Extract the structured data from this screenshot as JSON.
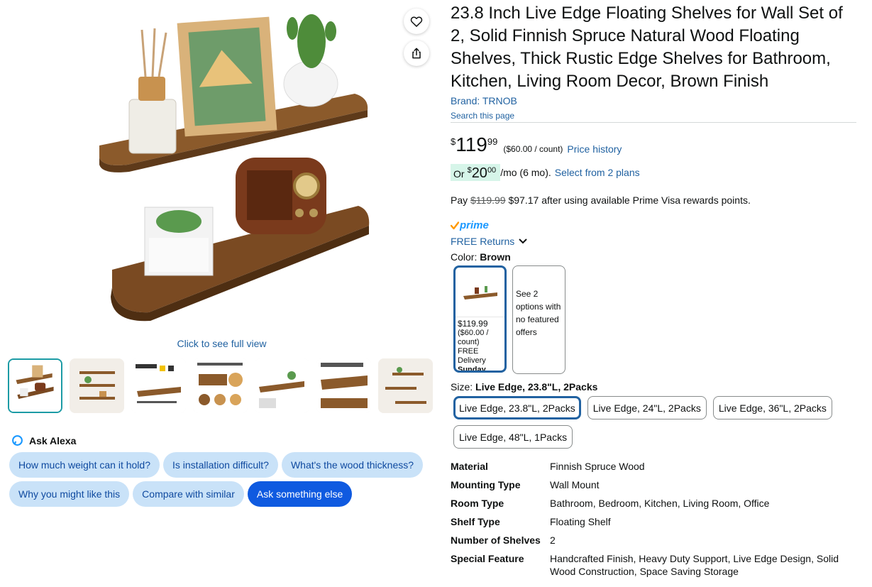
{
  "gallery": {
    "full_view_link": "Click to see full view",
    "thumbnails": [
      {
        "selected": true
      },
      {
        "selected": false
      },
      {
        "selected": false
      },
      {
        "selected": false
      },
      {
        "selected": false
      },
      {
        "selected": false
      },
      {
        "selected": false
      }
    ],
    "actions": {
      "wishlist_icon": "heart-icon",
      "share_icon": "share-icon"
    }
  },
  "alexa": {
    "title": "Ask Alexa",
    "chips": [
      "How much weight can it hold?",
      "Is installation difficult?",
      "What's the wood thickness?",
      "Why you might like this",
      "Compare with similar",
      "Ask something else"
    ]
  },
  "product": {
    "title": "23.8 Inch Live Edge Floating Shelves for Wall Set of 2, Solid Finnish Spruce Natural Wood Floating Shelves, Thick Rustic Edge Shelves for Bathroom, Kitchen, Living Room Decor, Brown Finish",
    "brand": "Brand: TRNOB",
    "search_page": "Search this page"
  },
  "price": {
    "symbol": "$",
    "whole": "119",
    "fraction": "99",
    "unit_price": "($60.00 / count)",
    "history_link": "Price history"
  },
  "installment": {
    "prefix": "Or",
    "symbol": "$",
    "whole": "20",
    "fraction": "00",
    "suffix": "/mo (6 mo).",
    "plans_link": "Select from 2 plans"
  },
  "pay": {
    "prefix": "Pay",
    "old_price": "$119.99",
    "text": "$97.17 after using available Prime Visa rewards points."
  },
  "prime": {
    "label": "prime",
    "returns": "FREE Returns"
  },
  "color": {
    "label": "Color:",
    "value": "Brown",
    "swatch": {
      "price": "$119.99",
      "unit": "($60.00 / count)",
      "delivery": "FREE Delivery",
      "day": "Sunday"
    },
    "other_options": "See 2 options with no featured offers"
  },
  "size": {
    "label": "Size:",
    "value": "Live Edge, 23.8\"L, 2Packs",
    "options": [
      "Live Edge, 23.8\"L, 2Packs",
      "Live Edge, 24\"L, 2Packs",
      "Live Edge, 36\"L, 2Packs",
      "Live Edge, 48\"L, 1Packs"
    ]
  },
  "specs": [
    {
      "key": "Material",
      "value": "Finnish Spruce Wood"
    },
    {
      "key": "Mounting Type",
      "value": "Wall Mount"
    },
    {
      "key": "Room Type",
      "value": "Bathroom, Bedroom, Kitchen, Living Room, Office"
    },
    {
      "key": "Shelf Type",
      "value": "Floating Shelf"
    },
    {
      "key": "Number of Shelves",
      "value": "2"
    },
    {
      "key": "Special Feature",
      "value": "Handcrafted Finish, Heavy Duty Support, Live Edge Design, Solid Wood Construction, Space Saving Storage"
    }
  ],
  "colors": {
    "link": "#2162A1",
    "chip_bg": "#C9E2F8",
    "chip_primary": "#0F5AE0",
    "selected_border": "#2162A1",
    "prime_blue": "#1A98FF",
    "prime_check": "#FF9900",
    "installment_bg": "#D6F5E9"
  }
}
